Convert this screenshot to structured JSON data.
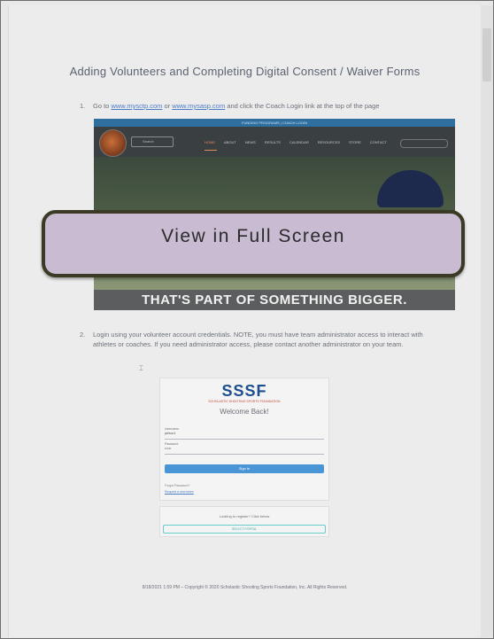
{
  "document": {
    "title": "Adding Volunteers and Completing Digital Consent / Waiver Forms",
    "steps": [
      {
        "num": "1.",
        "pre": "Go to ",
        "link1": "www.mysctp.com",
        "mid": " or ",
        "link2": "www.mysasp.com",
        "post": " and click the Coach Login link at the top of the page"
      },
      {
        "num": "2.",
        "text": "Login using your volunteer account credentials. NOTE, you must have team administrator access to interact with athletes or coaches. If you need administrator access, please contact another administrator on your team."
      }
    ],
    "footer": "8/18/2021 1:59 PM – Copyright © 2020 Scholastic Shooting Sports Foundation, Inc. All Rights Reserved."
  },
  "website_screenshot": {
    "topbar_text": "FUNDING PROGRAMS | COACH LOGIN",
    "search_label": "Search",
    "menu": [
      "HOME",
      "ABOUT",
      "NEWS",
      "RESULTS",
      "CALENDAR",
      "RESOURCES",
      "STORE",
      "CONTACT"
    ],
    "slogan": "THAT'S PART OF SOMETHING BIGGER."
  },
  "login_screenshot": {
    "logo": "SSSF",
    "logo_sub": "SCHOLASTIC SHOOTING SPORTS FOUNDATION",
    "welcome": "Welcome Back!",
    "username_label": "Username",
    "username_value": "jwilson1",
    "password_label": "Password",
    "password_value": "••••••",
    "button": "Sign In",
    "forgot": "Forgot Password?",
    "link": "Request a new token",
    "register_text": "Looking to register? Click below",
    "register_button": "SELECT PORTAL"
  },
  "overlay": {
    "label": "View in Full Screen"
  }
}
